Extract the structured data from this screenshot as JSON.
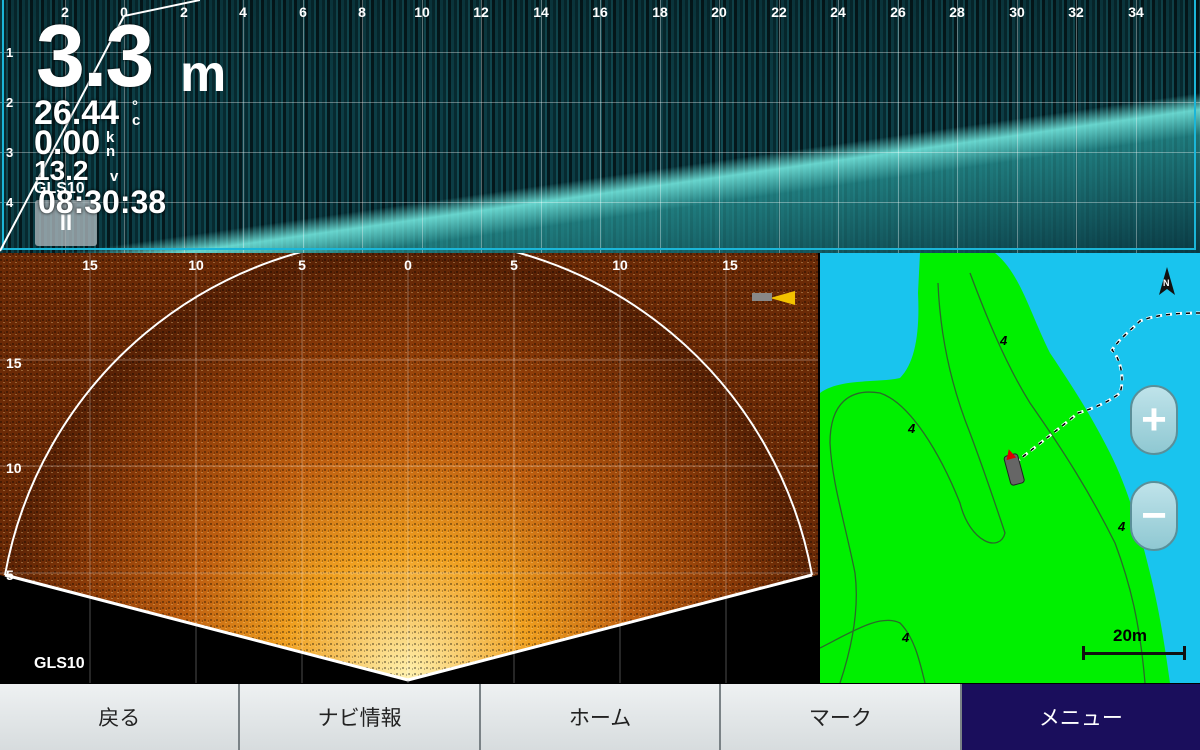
{
  "top_sonar": {
    "range_ticks": [
      "2",
      "0",
      "2",
      "4",
      "6",
      "8",
      "10",
      "12",
      "14",
      "16",
      "18",
      "20",
      "22",
      "24",
      "26",
      "28",
      "30",
      "32",
      "34"
    ],
    "depth_ticks": [
      "1",
      "2",
      "3",
      "4"
    ],
    "depth": "3.3",
    "depth_unit": "m",
    "temperature": "26.44",
    "temperature_unit": "°c",
    "speed": "0.00",
    "speed_unit_top": "k",
    "speed_unit_bottom": "n",
    "voltage": "13.2",
    "voltage_unit": "v",
    "clock": "08:30:38",
    "sensor": "GLS10",
    "pause_symbol": "II"
  },
  "scan_sonar": {
    "range_ticks": [
      "15",
      "10",
      "5",
      "0",
      "5",
      "10",
      "15"
    ],
    "depth_ticks": [
      "15",
      "10",
      "5"
    ],
    "sensor": "GLS10"
  },
  "map": {
    "north_label": "N",
    "contour_label": "4",
    "zoom_in": "+",
    "zoom_out": "−",
    "scale": "20m",
    "colors": {
      "water": "#19c4ee",
      "land": "#00f000"
    }
  },
  "bottom_bar": {
    "back": "戻る",
    "navi_info": "ナビ情報",
    "home": "ホーム",
    "mark": "マーク",
    "menu": "メニュー"
  }
}
